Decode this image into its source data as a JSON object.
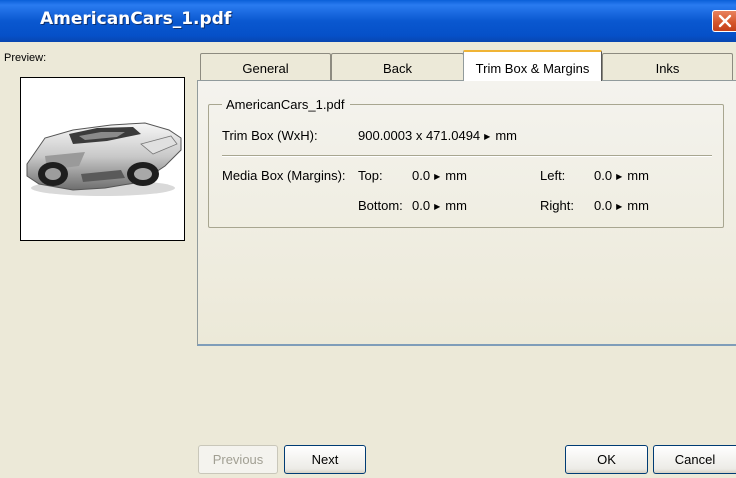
{
  "window": {
    "title": "AmericanCars_1.pdf"
  },
  "preview": {
    "label": "Preview:"
  },
  "tabs": [
    {
      "label": "General"
    },
    {
      "label": "Back"
    },
    {
      "label": "Trim Box & Margins",
      "active": true
    },
    {
      "label": "Inks"
    }
  ],
  "group": {
    "title": "AmericanCars_1.pdf",
    "trim_label": "Trim Box (WxH):",
    "trim_value": "900.0003 x 471.0494",
    "trim_unit": "mm",
    "media_label": "Media Box (Margins):",
    "top_label": "Top:",
    "top_value": "0.0",
    "top_unit": "mm",
    "left_label": "Left:",
    "left_value": "0.0",
    "left_unit": "mm",
    "bottom_label": "Bottom:",
    "bottom_value": "0.0",
    "bottom_unit": "mm",
    "right_label": "Right:",
    "right_value": "0.0",
    "right_unit": "mm"
  },
  "buttons": {
    "previous": "Previous",
    "next": "Next",
    "ok": "OK",
    "cancel": "Cancel"
  }
}
